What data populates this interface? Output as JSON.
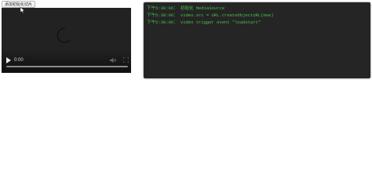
{
  "toolbar": {
    "init_button_label": "添加初始化切片"
  },
  "video": {
    "current_time": "0:00",
    "icons": {
      "play": "play-icon",
      "mute": "volume-muted-icon",
      "fullscreen": "fullscreen-icon",
      "loading": "loading-spinner-icon",
      "cursor": "mouse-pointer-icon"
    },
    "progress": 0
  },
  "log": {
    "text_color": "#4cc14c",
    "background": "#252525",
    "lines": [
      "下午5:38:06： 初始化 MediaSource",
      "下午5:38:06： video.src = URL.createObjectURL(mse)",
      "下午5:38:06： video trigger event \"loadstart\""
    ]
  }
}
